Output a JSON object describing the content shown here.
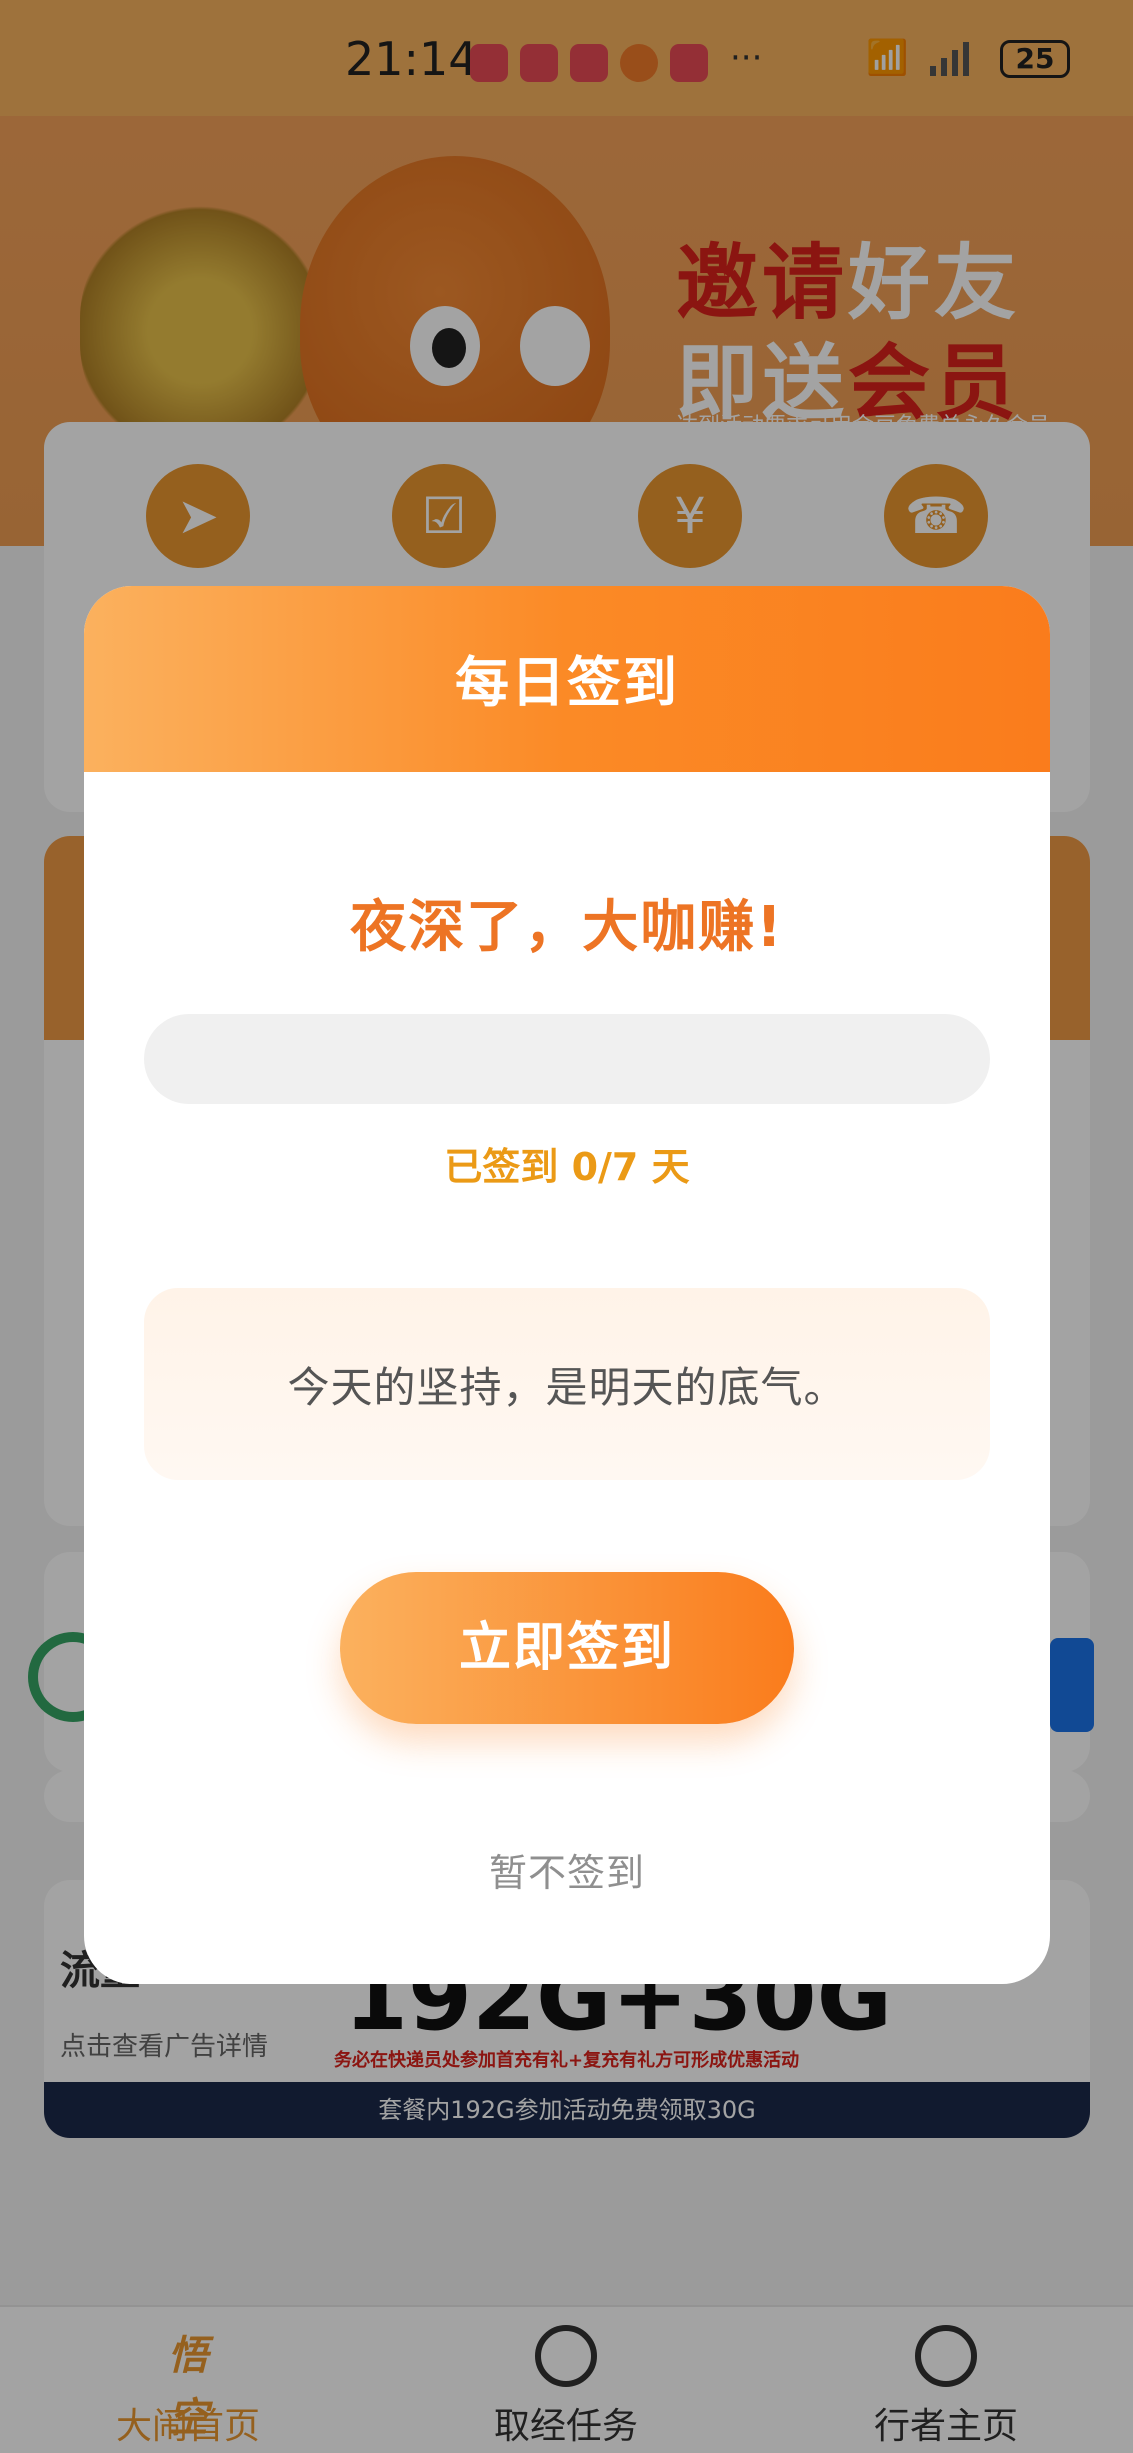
{
  "status_bar": {
    "time": "21:14",
    "overflow": "···",
    "network": "6",
    "battery": "25",
    "app_icons": [
      "huawei-store-icon",
      "huawei-store-icon",
      "huawei-store-icon",
      "orange-app-icon",
      "video-app-icon"
    ]
  },
  "banner": {
    "line1_red": "邀请",
    "line1_white": "好友",
    "line2_white": "即送",
    "line2_red": "会员",
    "note": "达到活动要求可用金豆免费兑永久会员",
    "accent_color": "#d9221b"
  },
  "quick_icons": [
    "compass-icon",
    "calendar-check-icon",
    "yuan-icon",
    "headset-icon"
  ],
  "ad": {
    "title": "流量",
    "subtitle": "点击查看广告详情",
    "headline": "192G+30G",
    "note": "务必在快递员处参加首充有礼+复充有礼方可形成优惠活动",
    "strip": "套餐内192G参加活动免费领取30G"
  },
  "dialog": {
    "title": "每日签到",
    "greeting": "夜深了，大咖赚!",
    "progress": {
      "signed_days": 0,
      "total_days": 7,
      "fraction": 0.0,
      "label": "已签到 0/7 天"
    },
    "quote": "今天的坚持，是明天的底气。",
    "sign_button": "立即签到",
    "skip_link": "暂不签到",
    "accent_color": "#fa7c1c"
  },
  "bottom_nav": {
    "items": [
      {
        "label": "大闹首页",
        "icon": "home-logo-icon",
        "active": true
      },
      {
        "label": "取经任务",
        "icon": "atom-icon",
        "active": false
      },
      {
        "label": "行者主页",
        "icon": "user-icon",
        "active": false
      }
    ],
    "logo_text": "悟空"
  }
}
